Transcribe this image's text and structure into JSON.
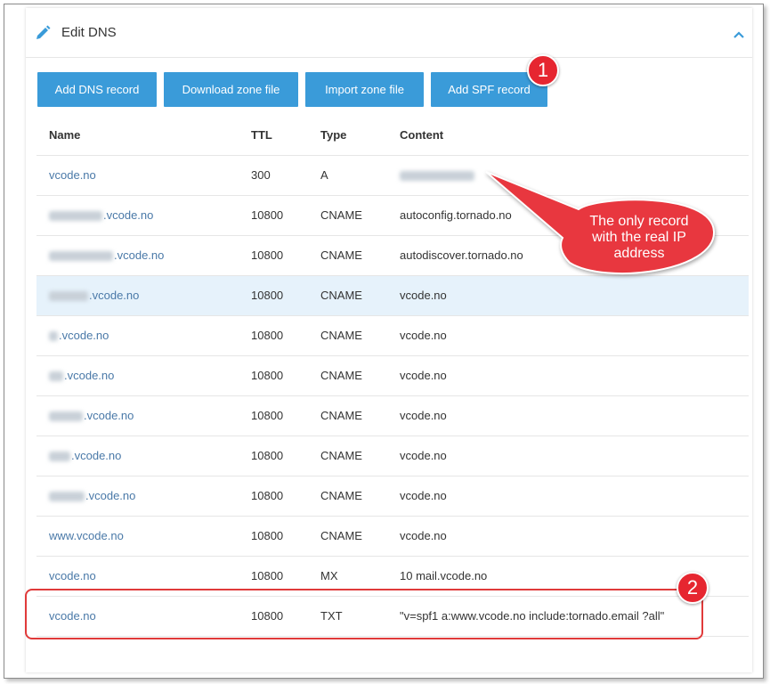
{
  "panel": {
    "title": "Edit DNS"
  },
  "toolbar": {
    "add_dns_label": "Add DNS record",
    "download_label": "Download zone file",
    "import_label": "Import zone file",
    "add_spf_label": "Add SPF record"
  },
  "table": {
    "headers": {
      "name": "Name",
      "ttl": "TTL",
      "type": "Type",
      "content": "Content"
    },
    "rows": [
      {
        "name": "vcode.no",
        "ttl": "300",
        "type": "A",
        "content": ""
      },
      {
        "name": ".vcode.no",
        "ttl": "10800",
        "type": "CNAME",
        "content": "autoconfig.tornado.no"
      },
      {
        "name": ".vcode.no",
        "ttl": "10800",
        "type": "CNAME",
        "content": "autodiscover.tornado.no"
      },
      {
        "name": ".vcode.no",
        "ttl": "10800",
        "type": "CNAME",
        "content": "vcode.no"
      },
      {
        "name": ".vcode.no",
        "ttl": "10800",
        "type": "CNAME",
        "content": "vcode.no"
      },
      {
        "name": ".vcode.no",
        "ttl": "10800",
        "type": "CNAME",
        "content": "vcode.no"
      },
      {
        "name": ".vcode.no",
        "ttl": "10800",
        "type": "CNAME",
        "content": "vcode.no"
      },
      {
        "name": ".vcode.no",
        "ttl": "10800",
        "type": "CNAME",
        "content": "vcode.no"
      },
      {
        "name": ".vcode.no",
        "ttl": "10800",
        "type": "CNAME",
        "content": "vcode.no"
      },
      {
        "name": "www.vcode.no",
        "ttl": "10800",
        "type": "CNAME",
        "content": "vcode.no"
      },
      {
        "name": "vcode.no",
        "ttl": "10800",
        "type": "MX",
        "content": "10 mail.vcode.no"
      },
      {
        "name": "vcode.no",
        "ttl": "10800",
        "type": "TXT",
        "content": "\"v=spf1 a:www.vcode.no include:tornado.email ?all\""
      }
    ]
  },
  "annotations": {
    "badge1": "1",
    "badge2": "2",
    "callout_line1": "The only record",
    "callout_line2": "with the real IP",
    "callout_line3": "address",
    "callout_color": "#e8373f"
  },
  "colors": {
    "button": "#3a9bd9",
    "link": "#4a79a8",
    "highlight_row": "#e6f2fb"
  }
}
